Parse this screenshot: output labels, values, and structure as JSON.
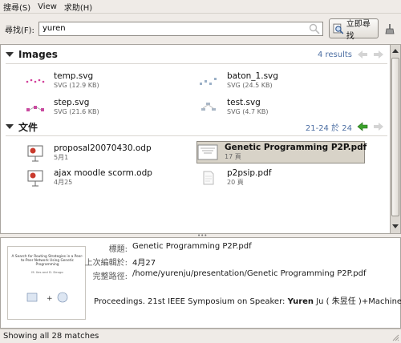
{
  "menu": {
    "items": [
      "搜尋(S)",
      "View",
      "求助(H)"
    ]
  },
  "search": {
    "label": "尋找(F):",
    "value": "yuren",
    "button_label": "立即尋找"
  },
  "categories": [
    {
      "title": "Images",
      "count": "4 results",
      "items": [
        {
          "name": "temp.svg",
          "sub": "SVG (12.9 KB)",
          "icon": "svg-thumbnail-icon"
        },
        {
          "name": "baton_1.svg",
          "sub": "SVG (24.5 KB)",
          "icon": "svg-thumbnail-icon"
        },
        {
          "name": "step.svg",
          "sub": "SVG (21.6 KB)",
          "icon": "svg-thumbnail-icon"
        },
        {
          "name": "test.svg",
          "sub": "SVG (4.7 KB)",
          "icon": "svg-thumbnail-icon"
        }
      ]
    },
    {
      "title": "文件",
      "count": "21-24 於 24",
      "items": [
        {
          "name": "proposal20070430.odp",
          "sub": "5月1",
          "icon": "presentation-icon"
        },
        {
          "name": "Genetic Programming P2P.pdf",
          "sub": "17 頁",
          "icon": "pdf-thumbnail-icon",
          "selected": true
        },
        {
          "name": "ajax moodle scorm.odp",
          "sub": "4月25",
          "icon": "presentation-icon"
        },
        {
          "name": "p2psip.pdf",
          "sub": "20 頁",
          "icon": "document-icon"
        }
      ]
    }
  ],
  "preview": {
    "thumb_title": "A Search for Routing Strategies in a Peer-to-Peer Network Using Genetic Programming",
    "thumb_authors": "M. Iles and D. Deugo",
    "title_key": "標題:",
    "title_value": "Genetic Programming P2P.pdf",
    "edited_key": "上次編輯於:",
    "edited_value": "4月27",
    "path_key": "完整路徑:",
    "path_value": "/home/yurenju/presentation/Genetic Programming P2P.pdf",
    "snippet_before": "Proceedings. 21st IEEE Symposium on Speaker: ",
    "snippet_match": "Yuren",
    "snippet_after": " Ju ( 朱昱任 )+Machine Le..."
  },
  "status": "Showing all 28 matches",
  "colors": {
    "count_text": "#4d6fa3",
    "nav_green": "#3aa12a",
    "selected_bg": "#d8d3c8"
  }
}
